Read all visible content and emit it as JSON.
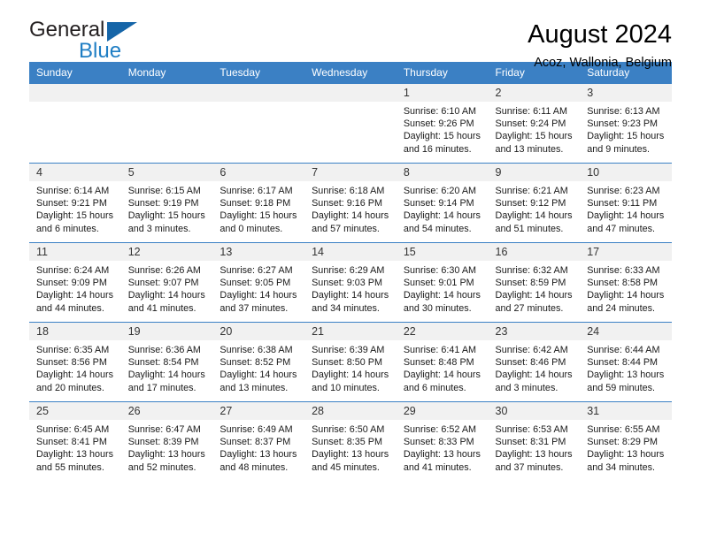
{
  "brand": {
    "name_part1": "General",
    "name_part2": "Blue",
    "logo_icon": "triangle-logo-icon",
    "colors": {
      "general_text": "#231f20",
      "blue_text": "#1f7ec4",
      "triangle": "#1565a8",
      "header_row": "#3b80c4",
      "daynum_bar": "#f1f1f1"
    }
  },
  "header": {
    "month_title": "August 2024",
    "location": "Acoz, Wallonia, Belgium"
  },
  "calendar": {
    "weekday_headers": [
      "Sunday",
      "Monday",
      "Tuesday",
      "Wednesday",
      "Thursday",
      "Friday",
      "Saturday"
    ],
    "weeks": [
      [
        {
          "day": "",
          "lines": []
        },
        {
          "day": "",
          "lines": []
        },
        {
          "day": "",
          "lines": []
        },
        {
          "day": "",
          "lines": []
        },
        {
          "day": "1",
          "lines": [
            "Sunrise: 6:10 AM",
            "Sunset: 9:26 PM",
            "Daylight: 15 hours",
            "and 16 minutes."
          ]
        },
        {
          "day": "2",
          "lines": [
            "Sunrise: 6:11 AM",
            "Sunset: 9:24 PM",
            "Daylight: 15 hours",
            "and 13 minutes."
          ]
        },
        {
          "day": "3",
          "lines": [
            "Sunrise: 6:13 AM",
            "Sunset: 9:23 PM",
            "Daylight: 15 hours",
            "and 9 minutes."
          ]
        }
      ],
      [
        {
          "day": "4",
          "lines": [
            "Sunrise: 6:14 AM",
            "Sunset: 9:21 PM",
            "Daylight: 15 hours",
            "and 6 minutes."
          ]
        },
        {
          "day": "5",
          "lines": [
            "Sunrise: 6:15 AM",
            "Sunset: 9:19 PM",
            "Daylight: 15 hours",
            "and 3 minutes."
          ]
        },
        {
          "day": "6",
          "lines": [
            "Sunrise: 6:17 AM",
            "Sunset: 9:18 PM",
            "Daylight: 15 hours",
            "and 0 minutes."
          ]
        },
        {
          "day": "7",
          "lines": [
            "Sunrise: 6:18 AM",
            "Sunset: 9:16 PM",
            "Daylight: 14 hours",
            "and 57 minutes."
          ]
        },
        {
          "day": "8",
          "lines": [
            "Sunrise: 6:20 AM",
            "Sunset: 9:14 PM",
            "Daylight: 14 hours",
            "and 54 minutes."
          ]
        },
        {
          "day": "9",
          "lines": [
            "Sunrise: 6:21 AM",
            "Sunset: 9:12 PM",
            "Daylight: 14 hours",
            "and 51 minutes."
          ]
        },
        {
          "day": "10",
          "lines": [
            "Sunrise: 6:23 AM",
            "Sunset: 9:11 PM",
            "Daylight: 14 hours",
            "and 47 minutes."
          ]
        }
      ],
      [
        {
          "day": "11",
          "lines": [
            "Sunrise: 6:24 AM",
            "Sunset: 9:09 PM",
            "Daylight: 14 hours",
            "and 44 minutes."
          ]
        },
        {
          "day": "12",
          "lines": [
            "Sunrise: 6:26 AM",
            "Sunset: 9:07 PM",
            "Daylight: 14 hours",
            "and 41 minutes."
          ]
        },
        {
          "day": "13",
          "lines": [
            "Sunrise: 6:27 AM",
            "Sunset: 9:05 PM",
            "Daylight: 14 hours",
            "and 37 minutes."
          ]
        },
        {
          "day": "14",
          "lines": [
            "Sunrise: 6:29 AM",
            "Sunset: 9:03 PM",
            "Daylight: 14 hours",
            "and 34 minutes."
          ]
        },
        {
          "day": "15",
          "lines": [
            "Sunrise: 6:30 AM",
            "Sunset: 9:01 PM",
            "Daylight: 14 hours",
            "and 30 minutes."
          ]
        },
        {
          "day": "16",
          "lines": [
            "Sunrise: 6:32 AM",
            "Sunset: 8:59 PM",
            "Daylight: 14 hours",
            "and 27 minutes."
          ]
        },
        {
          "day": "17",
          "lines": [
            "Sunrise: 6:33 AM",
            "Sunset: 8:58 PM",
            "Daylight: 14 hours",
            "and 24 minutes."
          ]
        }
      ],
      [
        {
          "day": "18",
          "lines": [
            "Sunrise: 6:35 AM",
            "Sunset: 8:56 PM",
            "Daylight: 14 hours",
            "and 20 minutes."
          ]
        },
        {
          "day": "19",
          "lines": [
            "Sunrise: 6:36 AM",
            "Sunset: 8:54 PM",
            "Daylight: 14 hours",
            "and 17 minutes."
          ]
        },
        {
          "day": "20",
          "lines": [
            "Sunrise: 6:38 AM",
            "Sunset: 8:52 PM",
            "Daylight: 14 hours",
            "and 13 minutes."
          ]
        },
        {
          "day": "21",
          "lines": [
            "Sunrise: 6:39 AM",
            "Sunset: 8:50 PM",
            "Daylight: 14 hours",
            "and 10 minutes."
          ]
        },
        {
          "day": "22",
          "lines": [
            "Sunrise: 6:41 AM",
            "Sunset: 8:48 PM",
            "Daylight: 14 hours",
            "and 6 minutes."
          ]
        },
        {
          "day": "23",
          "lines": [
            "Sunrise: 6:42 AM",
            "Sunset: 8:46 PM",
            "Daylight: 14 hours",
            "and 3 minutes."
          ]
        },
        {
          "day": "24",
          "lines": [
            "Sunrise: 6:44 AM",
            "Sunset: 8:44 PM",
            "Daylight: 13 hours",
            "and 59 minutes."
          ]
        }
      ],
      [
        {
          "day": "25",
          "lines": [
            "Sunrise: 6:45 AM",
            "Sunset: 8:41 PM",
            "Daylight: 13 hours",
            "and 55 minutes."
          ]
        },
        {
          "day": "26",
          "lines": [
            "Sunrise: 6:47 AM",
            "Sunset: 8:39 PM",
            "Daylight: 13 hours",
            "and 52 minutes."
          ]
        },
        {
          "day": "27",
          "lines": [
            "Sunrise: 6:49 AM",
            "Sunset: 8:37 PM",
            "Daylight: 13 hours",
            "and 48 minutes."
          ]
        },
        {
          "day": "28",
          "lines": [
            "Sunrise: 6:50 AM",
            "Sunset: 8:35 PM",
            "Daylight: 13 hours",
            "and 45 minutes."
          ]
        },
        {
          "day": "29",
          "lines": [
            "Sunrise: 6:52 AM",
            "Sunset: 8:33 PM",
            "Daylight: 13 hours",
            "and 41 minutes."
          ]
        },
        {
          "day": "30",
          "lines": [
            "Sunrise: 6:53 AM",
            "Sunset: 8:31 PM",
            "Daylight: 13 hours",
            "and 37 minutes."
          ]
        },
        {
          "day": "31",
          "lines": [
            "Sunrise: 6:55 AM",
            "Sunset: 8:29 PM",
            "Daylight: 13 hours",
            "and 34 minutes."
          ]
        }
      ]
    ]
  }
}
